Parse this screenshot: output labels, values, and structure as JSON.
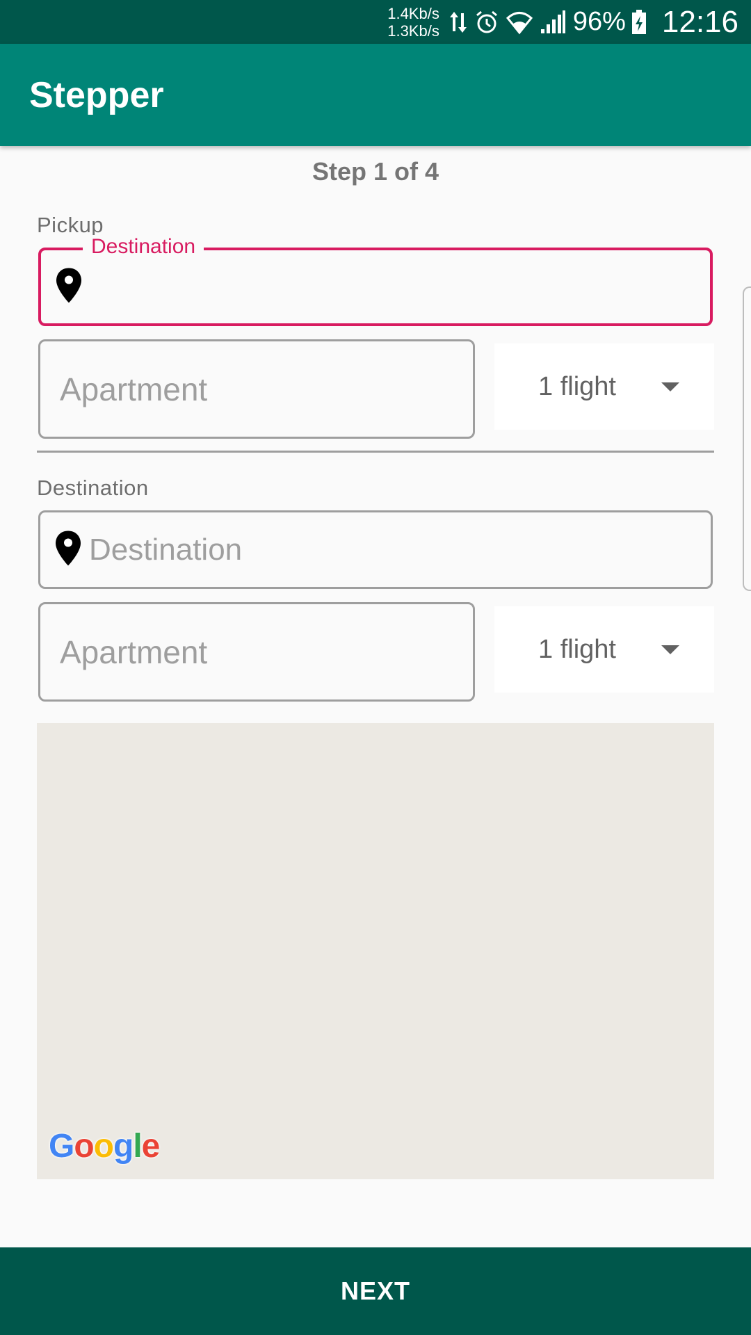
{
  "status_bar": {
    "net_up": "1.4Kb/s",
    "net_down": "1.3Kb/s",
    "battery": "96%",
    "time": "12:16",
    "icons": [
      "data-transfer-icon",
      "alarm-icon",
      "wifi-icon",
      "signal-icon",
      "battery-charging-icon"
    ]
  },
  "app_bar": {
    "title": "Stepper"
  },
  "stepper": {
    "step_label": "Step 1 of 4"
  },
  "pickup": {
    "section_label": "Pickup",
    "destination_label": "Destination",
    "destination_value": "",
    "apartment_placeholder": "Apartment",
    "flight_value": "1 flight"
  },
  "destination": {
    "section_label": "Destination",
    "destination_placeholder": "Destination",
    "apartment_placeholder": "Apartment",
    "flight_value": "1 flight"
  },
  "map": {
    "logo_letters": [
      "G",
      "o",
      "o",
      "g",
      "l",
      "e"
    ],
    "logo_colors": [
      "#4285F4",
      "#EA4335",
      "#FBBC05",
      "#4285F4",
      "#34A853",
      "#EA4335"
    ]
  },
  "footer": {
    "next_label": "NEXT"
  },
  "colors": {
    "status_bar": "#00574b",
    "app_bar": "#008577",
    "accent": "#d81b60",
    "footer": "#00574b",
    "map_background": "#ece9e3"
  }
}
